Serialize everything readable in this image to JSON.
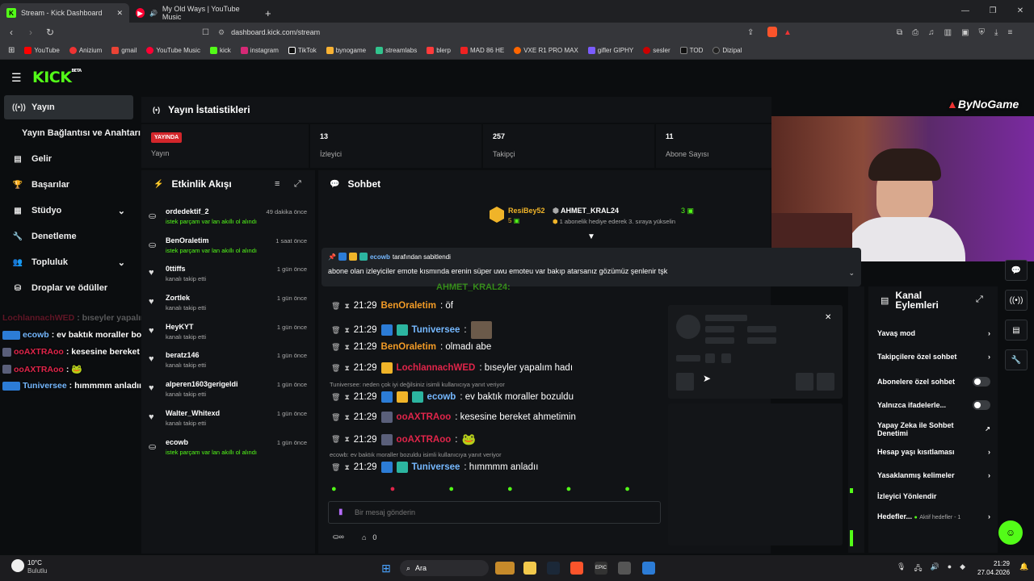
{
  "browser": {
    "tabs": [
      {
        "title": "Stream - Kick Dashboard",
        "active": true
      },
      {
        "title": "My Old Ways | YouTube Music",
        "active": false
      }
    ],
    "url": "dashboard.kick.com/stream",
    "bookmarks": [
      "YouTube",
      "Anizium",
      "gmail",
      "YouTube Music",
      "kick",
      "instagram",
      "TikTok",
      "bynogame",
      "streamlabs",
      "blerp",
      "MAD 86 HE",
      "VXE R1 PRO MAX",
      "gifler GIPHY",
      "sesler",
      "TOD",
      "Dizipal"
    ],
    "colors": {
      "kick_green": "#53fc18",
      "youtube_red": "#ff0033"
    }
  },
  "header": {
    "logo": "KICK",
    "logo_tag": "BETA"
  },
  "sidebar": {
    "items": [
      {
        "label": "Yayın",
        "icon": "broadcast-icon"
      },
      {
        "label": "Yayın Bağlantısı ve Anahtarı",
        "icon": ""
      },
      {
        "label": "Gelir",
        "icon": "chart-icon"
      },
      {
        "label": "Başarılar",
        "icon": "trophy-icon"
      },
      {
        "label": "Stüdyo",
        "icon": "studio-icon"
      },
      {
        "label": "Denetleme",
        "icon": "wrench-icon"
      },
      {
        "label": "Topluluk",
        "icon": "people-icon"
      },
      {
        "label": "Droplar ve ödüller",
        "icon": "gift-icon"
      }
    ]
  },
  "stats": {
    "title": "Yayın İstatistikleri",
    "live_badge": "YAYINDA",
    "live_label": "Yayın",
    "viewers": {
      "value": "13",
      "label": "İzleyici"
    },
    "followers": {
      "value": "257",
      "label": "Takipçi"
    },
    "subs": {
      "value": "11",
      "label": "Abone Sayısı"
    }
  },
  "activity": {
    "title": "Etkinlik Akışı",
    "items": [
      {
        "user": "ordedektif_2",
        "time": "49 dakika önce",
        "desc": "istek parçam var lan akıllı ol alındı",
        "green": true
      },
      {
        "user": "BenOraletim",
        "time": "1 saat önce",
        "desc": "istek parçam var lan akıllı ol alındı",
        "green": true
      },
      {
        "user": "0ttiffs",
        "time": "1 gün önce",
        "desc": "kanalı takip etti",
        "green": false
      },
      {
        "user": "Zortlek",
        "time": "1 gün önce",
        "desc": "kanalı takip etti",
        "green": false
      },
      {
        "user": "HeyKYT",
        "time": "1 gün önce",
        "desc": "kanalı takip etti",
        "green": false
      },
      {
        "user": "beratz146",
        "time": "1 gün önce",
        "desc": "kanalı takip etti",
        "green": false
      },
      {
        "user": "alperen1603gerigeldi",
        "time": "1 gün önce",
        "desc": "kanalı takip etti",
        "green": false
      },
      {
        "user": "Walter_Whitexd",
        "time": "1 gün önce",
        "desc": "kanalı takip etti",
        "green": false
      },
      {
        "user": "ecowb",
        "time": "1 gün önce",
        "desc": "istek parçam var lan akıllı ol alındı",
        "green": true
      }
    ]
  },
  "chat": {
    "title": "Sohbet",
    "gifter": {
      "user": "ResiBey52",
      "count": "5",
      "target": "AHMET_KRAL24",
      "target_count": "3",
      "desc": "1 abonelik hediye ederek 3. sıraya yükselin"
    },
    "pinned": {
      "by": "ecowb",
      "label": "tarafından sabitlendi",
      "text": "abone olan izleyiciler emote kısmında erenin süper uwu emoteu var bakıp atarsanız gözümüz şenlenir tşk"
    },
    "partial": "AHMET_KRAL24:",
    "messages": [
      {
        "time": "21:29",
        "user": "BenOraletim",
        "color": "#f29b26",
        "text": ": öf"
      },
      {
        "time": "21:29",
        "user": "Tuniversee",
        "color": "#75b8ff",
        "text": ":"
      },
      {
        "time": "21:29",
        "user": "BenOraletim",
        "color": "#f29b26",
        "text": ": olmadı abe"
      },
      {
        "time": "21:29",
        "user": "LochlannachWED",
        "color": "#e0254a",
        "text": ": bıseyler yapalım hadı"
      },
      {
        "time": "21:29",
        "user": "ecowb",
        "color": "#75b8ff",
        "text": ": ev baktık moraller bozuldu"
      },
      {
        "time": "21:29",
        "user": "ooAXTRAoo",
        "color": "#e0254a",
        "text": ": kesesine bereket ahmetimin"
      },
      {
        "time": "21:29",
        "user": "ooAXTRAoo",
        "color": "#e0254a",
        "text": ":"
      },
      {
        "time": "21:29",
        "user": "Tuniversee",
        "color": "#75b8ff",
        "text": ": hımmmm anladıı"
      }
    ],
    "replies": [
      "Tuniversee: neden çok iyi değilsiniz isimli kullanıcıya yanıt veriyor",
      "ecowb: ev baktık moraller bozuldu isimli kullanıcıya yanıt veriyor"
    ],
    "placeholder": "Bir mesaj gönderin",
    "footer_count": "0"
  },
  "channel_actions": {
    "title": "Kanal Eylemleri",
    "items": [
      {
        "label": "Yavaş mod",
        "type": "arrow"
      },
      {
        "label": "Takipçilere özel sohbet",
        "type": "arrow"
      },
      {
        "label": "Abonelere özel sohbet",
        "type": "toggle"
      },
      {
        "label": "Yalnızca ifadelerle...",
        "type": "toggle"
      },
      {
        "label": "Yapay Zeka ile Sohbet Denetimi",
        "type": "external"
      },
      {
        "label": "Hesap yaşı kısıtlaması",
        "type": "arrow"
      },
      {
        "label": "Yasaklanmış kelimeler",
        "type": "arrow"
      },
      {
        "label": "İzleyici Yönlendir",
        "type": "none"
      },
      {
        "label": "Hedefler...",
        "type": "arrow",
        "extra": "Aktif hedefler - 1"
      }
    ]
  },
  "overlay": {
    "brand": "ByNoGame",
    "messages": [
      {
        "user": "LochlannachWED",
        "text": ": bıseyler yapalım hadı",
        "color": "#e0254a"
      },
      {
        "user": "ecowb",
        "text": ": ev baktık moraller bozuldu",
        "color": "#75b8ff"
      },
      {
        "user": "ooAXTRAoo",
        "text": ": kesesine bereket ahmetimin",
        "color": "#e0254a"
      },
      {
        "user": "ooAXTRAoo",
        "text": ":",
        "color": "#e0254a"
      },
      {
        "user": "Tuniversee",
        "text": ": hımmmm anladııı",
        "color": "#75b8ff"
      }
    ]
  },
  "taskbar": {
    "weather_temp": "10°C",
    "weather_desc": "Bulutlu",
    "search": "Ara",
    "time": "21:29",
    "date": "27.04.2026"
  }
}
